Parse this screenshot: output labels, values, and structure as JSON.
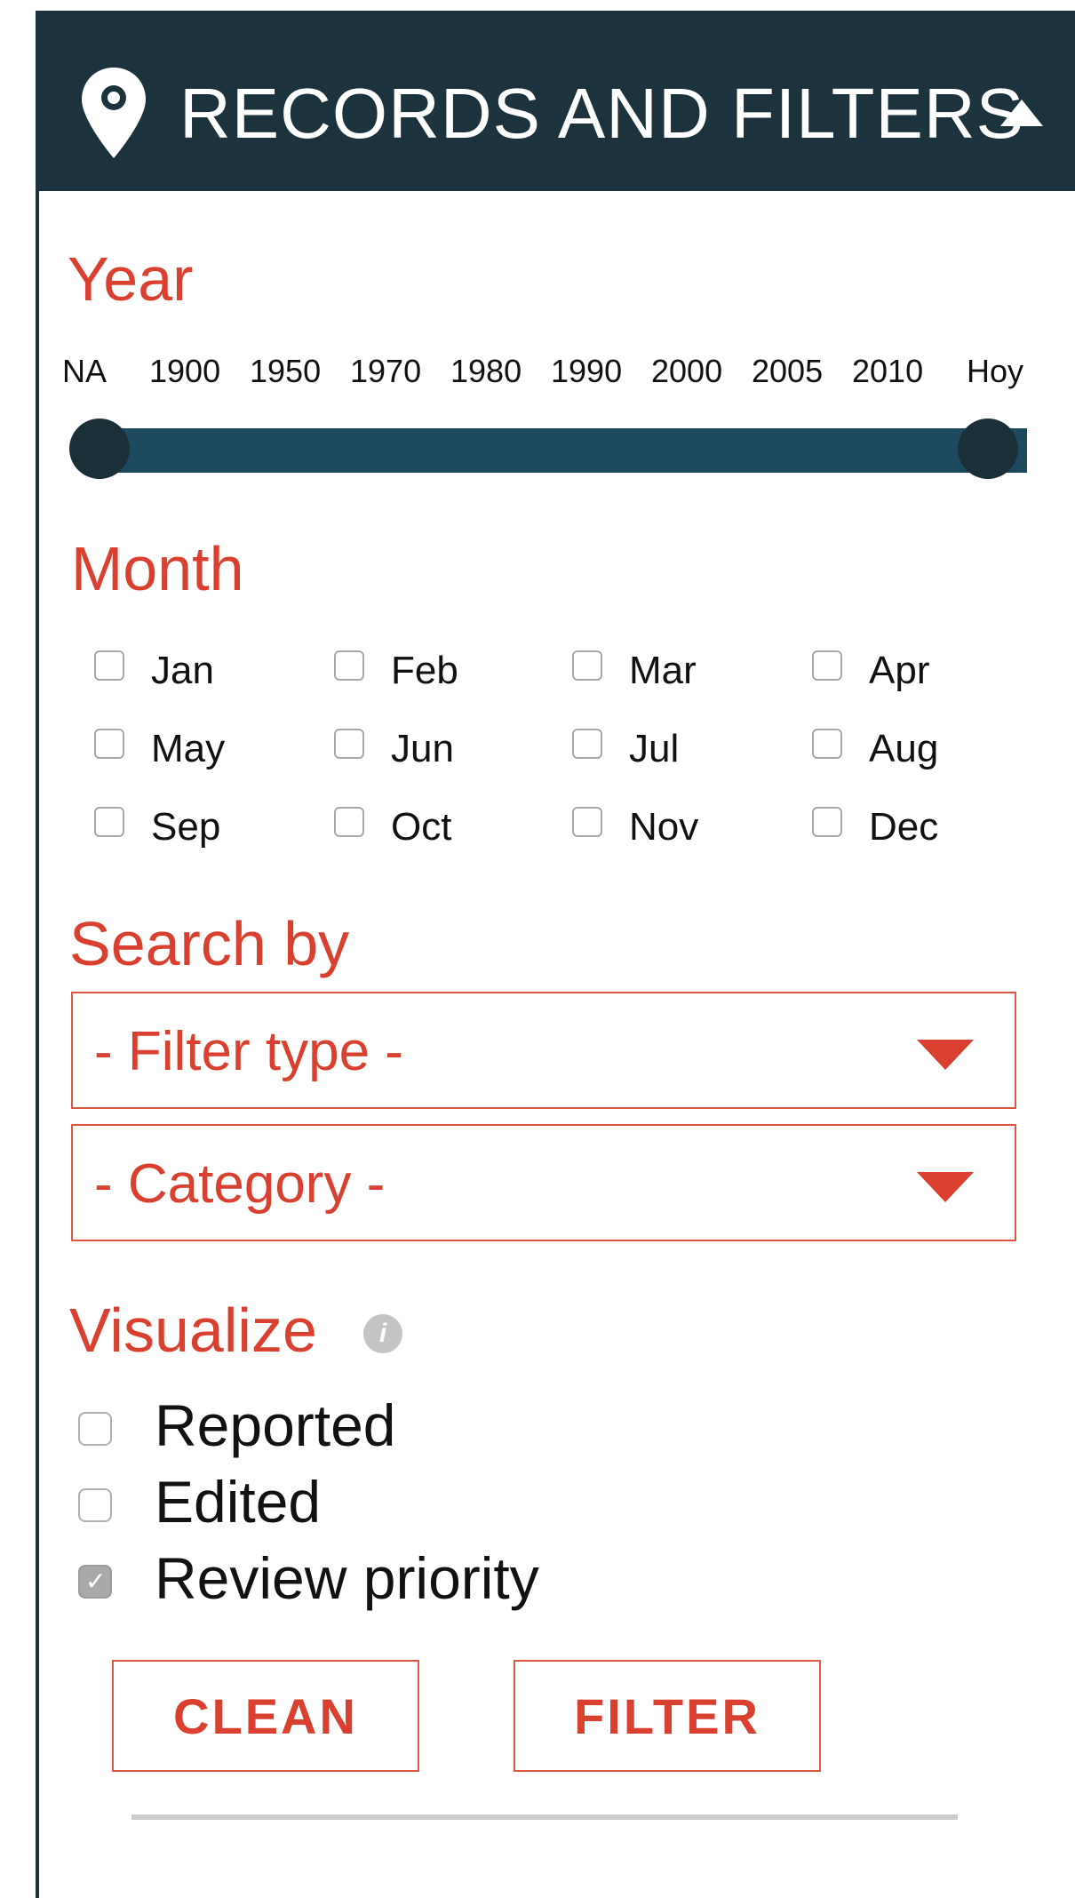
{
  "header": {
    "title": "RECORDS AND FILTERS"
  },
  "year": {
    "label": "Year",
    "ticks": [
      "NA",
      "1900",
      "1950",
      "1970",
      "1980",
      "1990",
      "2000",
      "2005",
      "2010",
      "Hoy"
    ],
    "selected_from": "NA",
    "selected_to": "Hoy"
  },
  "month": {
    "label": "Month",
    "items": [
      {
        "label": "Jan",
        "checked": false
      },
      {
        "label": "Feb",
        "checked": false
      },
      {
        "label": "Mar",
        "checked": false
      },
      {
        "label": "Apr",
        "checked": false
      },
      {
        "label": "May",
        "checked": false
      },
      {
        "label": "Jun",
        "checked": false
      },
      {
        "label": "Jul",
        "checked": false
      },
      {
        "label": "Aug",
        "checked": false
      },
      {
        "label": "Sep",
        "checked": false
      },
      {
        "label": "Oct",
        "checked": false
      },
      {
        "label": "Nov",
        "checked": false
      },
      {
        "label": "Dec",
        "checked": false
      }
    ]
  },
  "search": {
    "label": "Search by",
    "filter_type": "- Filter type -",
    "category": "- Category -"
  },
  "visualize": {
    "label": "Visualize",
    "info_icon": "i",
    "items": [
      {
        "label": "Reported",
        "checked": false
      },
      {
        "label": "Edited",
        "checked": false
      },
      {
        "label": "Review priority",
        "checked": true
      }
    ]
  },
  "buttons": {
    "clean": "CLEAN",
    "filter": "FILTER"
  },
  "colors": {
    "header_bg": "#1c333d",
    "accent": "#d9402f",
    "slider": "#1e4a5f"
  },
  "icons": {
    "header": "map-pin-icon",
    "collapse": "caret-up-icon",
    "info": "info-icon",
    "select": "caret-down-icon"
  }
}
